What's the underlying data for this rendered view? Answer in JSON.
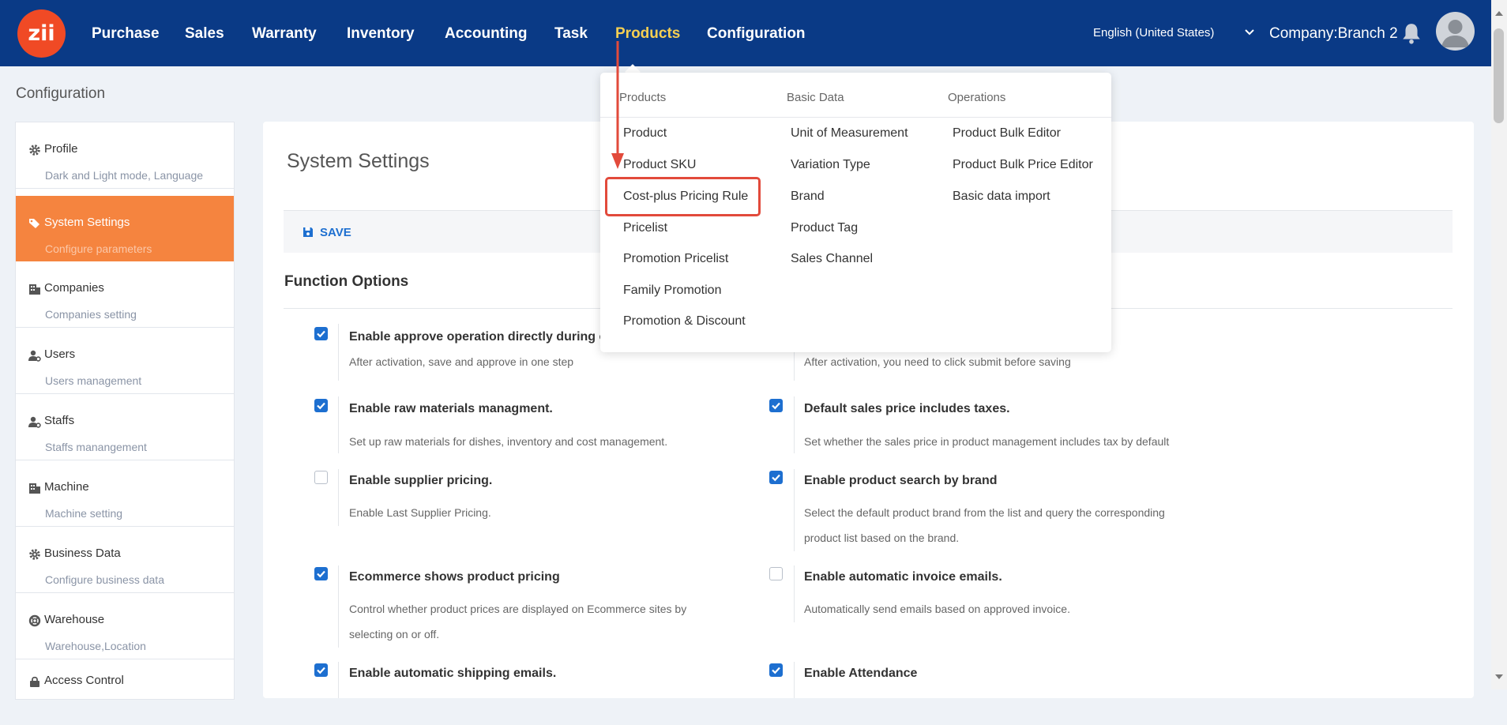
{
  "header": {
    "logo_text": "zii",
    "nav": [
      "Purchase",
      "Sales",
      "Warranty",
      "Inventory",
      "Accounting",
      "Task",
      "Products",
      "Configuration"
    ],
    "active_nav": "Products",
    "language": "English (United States)",
    "company": "Company:Branch 2"
  },
  "page_title": "Configuration",
  "sidebar": {
    "items": [
      {
        "label": "Profile",
        "sub": "Dark and Light mode, Language",
        "icon": "gear-icon"
      },
      {
        "label": "System Settings",
        "sub": "Configure parameters",
        "icon": "tags-icon"
      },
      {
        "label": "Companies",
        "sub": "Companies setting",
        "icon": "building-icon"
      },
      {
        "label": "Users",
        "sub": "Users management",
        "icon": "user-cog-icon"
      },
      {
        "label": "Staffs",
        "sub": "Staffs manangement",
        "icon": "user-cog-icon"
      },
      {
        "label": "Machine",
        "sub": "Machine setting",
        "icon": "building-icon"
      },
      {
        "label": "Business Data",
        "sub": "Configure business data",
        "icon": "gear-icon"
      },
      {
        "label": "Warehouse",
        "sub": "Warehouse,Location",
        "icon": "life-ring-icon"
      },
      {
        "label": "Access Control",
        "sub": "",
        "icon": "lock-icon"
      }
    ]
  },
  "main": {
    "title": "System Settings",
    "save_label": "SAVE",
    "section_title": "Function Options",
    "options": [
      {
        "label": "Enable approve operation directly during c",
        "desc": "After activation, save and approve in one step",
        "checked": true
      },
      {
        "label": "",
        "desc": "After activation, you need to click submit before saving",
        "checked": true
      },
      {
        "label": "Enable raw materials managment.",
        "desc": "Set up raw materials for dishes, inventory and cost management.",
        "checked": true
      },
      {
        "label": "Default sales price includes taxes.",
        "desc": "Set whether the sales price in product management includes tax by default",
        "checked": true
      },
      {
        "label": "Enable supplier pricing.",
        "desc": "Enable Last Supplier Pricing.",
        "checked": false
      },
      {
        "label": "Enable product search by brand",
        "desc": "Select the default product brand from the list and query the corresponding product list based on the brand.",
        "checked": true
      },
      {
        "label": "Ecommerce shows product pricing",
        "desc": "Control whether product prices are displayed on Ecommerce sites by selecting on or off.",
        "checked": true
      },
      {
        "label": "Enable automatic invoice emails.",
        "desc": "Automatically send emails based on approved invoice.",
        "checked": false
      },
      {
        "label": "Enable automatic shipping emails.",
        "desc": "",
        "checked": true
      },
      {
        "label": "Enable Attendance",
        "desc": "",
        "checked": true
      }
    ]
  },
  "menu": {
    "columns": [
      {
        "title": "Products",
        "items": [
          "Product",
          "Product SKU",
          "Cost-plus Pricing Rule",
          "Pricelist",
          "Promotion Pricelist",
          "Family Promotion",
          "Promotion & Discount"
        ]
      },
      {
        "title": "Basic Data",
        "items": [
          "Unit of Measurement",
          "Variation Type",
          "Brand",
          "Product Tag",
          "Sales Channel"
        ]
      },
      {
        "title": "Operations",
        "items": [
          "Product Bulk Editor",
          "Product Bulk Price Editor",
          "Basic data import"
        ]
      }
    ],
    "highlighted_item": "Cost-plus Pricing Rule"
  },
  "colors": {
    "header_bg": "#0a3a86",
    "active_nav": "#f6cf52",
    "accent": "#f5843f",
    "primary": "#1d6fd0",
    "annotation": "#e24a3b"
  }
}
